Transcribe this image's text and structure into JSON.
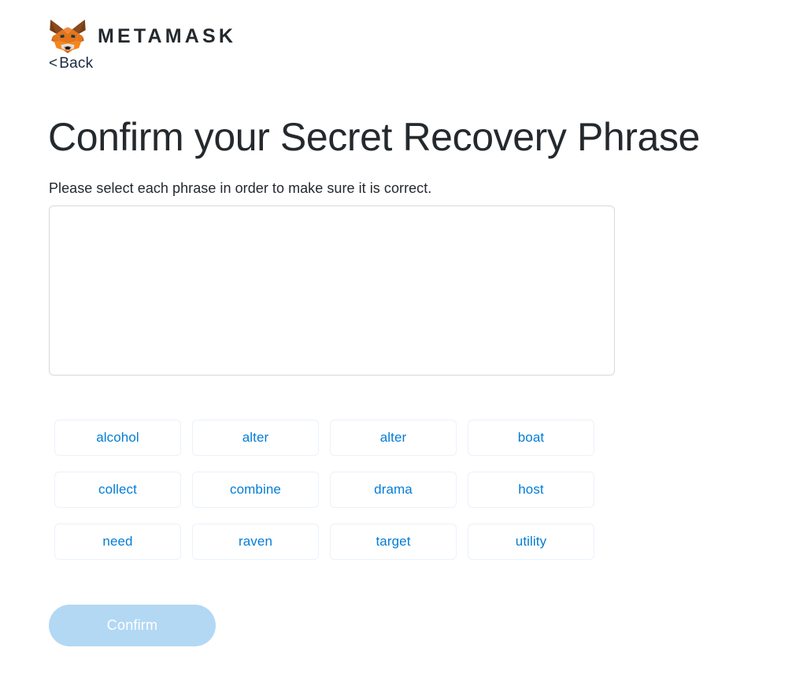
{
  "brand": {
    "logo_icon": "metamask-fox-icon",
    "wordmark": "METAMASK",
    "colors": {
      "fox_orange": "#E2761B",
      "fox_orange_light": "#F6851B",
      "fox_brown": "#763D16",
      "fox_brown_dark": "#633D20",
      "fox_snout": "#D7C1B3",
      "fox_white": "#E4E4E4"
    }
  },
  "nav": {
    "back_chevron": "<",
    "back_label": "Back"
  },
  "header": {
    "title": "Confirm your Secret Recovery Phrase",
    "subtitle": "Please select each phrase in order to make sure it is correct."
  },
  "selection_area": {
    "selected_words": [],
    "empty": true
  },
  "word_bank": {
    "words": [
      "alcohol",
      "alter",
      "alter",
      "boat",
      "collect",
      "combine",
      "drama",
      "host",
      "need",
      "raven",
      "target",
      "utility"
    ]
  },
  "actions": {
    "confirm_label": "Confirm",
    "confirm_disabled": true
  },
  "theme": {
    "accent_blue": "#037DD6",
    "disabled_blue": "#B3D8F4",
    "text_dark": "#24292E",
    "border_light": "#D6D9DC",
    "chip_border": "#EAF2FB"
  }
}
